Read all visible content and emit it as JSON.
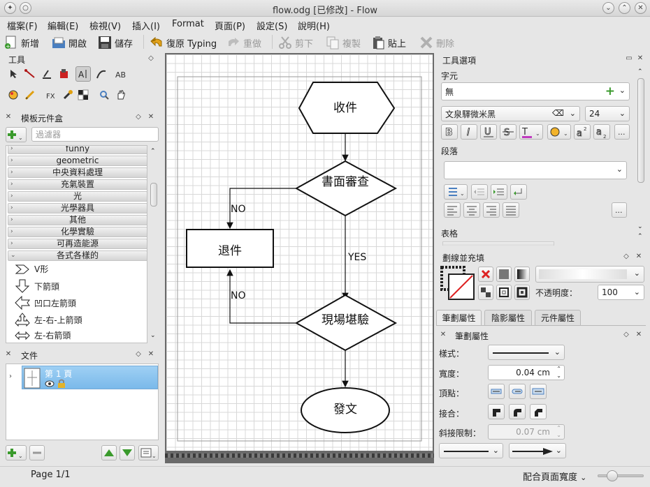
{
  "window": {
    "title": "flow.odg [已修改] - Flow"
  },
  "menu": [
    "檔案(F)",
    "編輯(E)",
    "檢視(V)",
    "插入(I)",
    "Format",
    "頁面(P)",
    "設定(S)",
    "說明(H)"
  ],
  "toolbar": {
    "new": "新增",
    "open": "開啟",
    "save": "儲存",
    "undo": "復原 Typing",
    "redo": "重做",
    "cut": "剪下",
    "copy": "複製",
    "paste": "貼上",
    "delete": "刪除"
  },
  "tools_panel": {
    "title": "工具"
  },
  "stencil_panel": {
    "title": "模板元件盒",
    "filter_placeholder": "過濾器",
    "categories": [
      "funny",
      "geometric",
      "中央資料處理",
      "充氣裝置",
      "光",
      "光學器具",
      "其他",
      "化學實驗",
      "可再造能源",
      "各式各樣的"
    ],
    "shapes": [
      "V形",
      "下箭頭",
      "凹口左箭頭",
      "左-右-上箭頭",
      "左-右箭頭"
    ]
  },
  "document_panel": {
    "title": "文件",
    "page_label": "第 1 頁"
  },
  "flowchart": {
    "receive": "收件",
    "review": "書面審查",
    "return": "退件",
    "inspect": "現場堪驗",
    "issue": "發文",
    "no_top": "NO",
    "yes": "YES",
    "no_bottom": "NO"
  },
  "tool_options": {
    "title": "工具選項",
    "char_section": "字元",
    "char_style": "無",
    "font": "文泉驛微米黑",
    "font_size": "24",
    "para_section": "段落",
    "table_section": "表格"
  },
  "stroke_fill": {
    "title": "劃線並充填",
    "opacity_label": "不透明度：",
    "opacity_value": "100"
  },
  "tabs": [
    "筆劃屬性",
    "陰影屬性",
    "元件屬性"
  ],
  "stroke_props": {
    "title": "筆劃屬性",
    "style_label": "樣式：",
    "width_label": "寬度：",
    "width_value": "0.04 cm",
    "cap_label": "頂點：",
    "join_label": "接合：",
    "miter_label": "斜接限制：",
    "miter_value": "0.07 cm"
  },
  "status": {
    "page": "Page 1/1",
    "zoom": "配合頁面寬度"
  }
}
